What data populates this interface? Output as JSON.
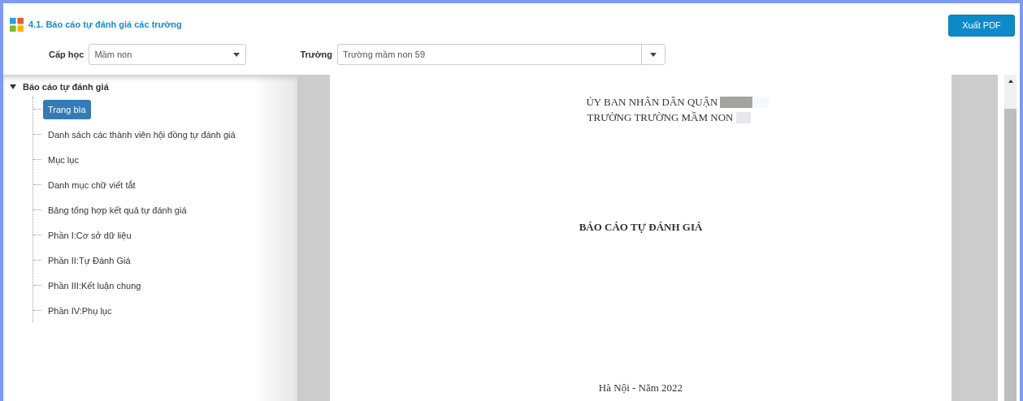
{
  "header": {
    "title": "4.1. Báo cáo tự đánh giá các trường",
    "export_button": "Xuất PDF"
  },
  "filters": [
    {
      "label": "Cấp học",
      "value": "Mầm non"
    },
    {
      "label": "Trường",
      "value": "Trường mầm non 59"
    }
  ],
  "tree": {
    "label": "Báo cáo tự đánh giá",
    "expanded": true,
    "children": [
      {
        "label": "Trang bìa",
        "selected": true
      },
      {
        "label": "Danh sách các thành viên hội đồng tự đánh giá",
        "selected": false
      },
      {
        "label": "Mục lục",
        "selected": false
      },
      {
        "label": "Danh mục chữ viết tắt",
        "selected": false
      },
      {
        "label": "Bảng tổng hợp kết quả tự đánh giá",
        "selected": false
      },
      {
        "label": "Phần I:Cơ sở dữ liệu",
        "selected": false
      },
      {
        "label": "Phần II:Tự Đánh Giá",
        "selected": false
      },
      {
        "label": "Phần III:Kết luận chung",
        "selected": false
      },
      {
        "label": "Phần IV:Phụ lục",
        "selected": false
      }
    ]
  },
  "document": {
    "lines": [
      "ỦY BAN NHÂN DÂN QUẬN",
      "TRƯỜNG TRƯỜNG MẦM NON"
    ],
    "title": "BÁO CÁO TỰ ĐÁNH GIÁ",
    "footer": "Hà Nội - Năm 2022"
  }
}
